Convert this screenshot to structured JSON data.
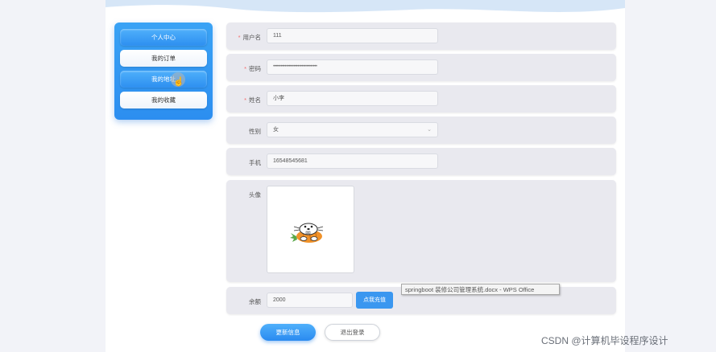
{
  "sidebar": {
    "items": [
      {
        "label": "个人中心",
        "active": true
      },
      {
        "label": "我的订单",
        "active": false
      },
      {
        "label": "我的地址",
        "active": true
      },
      {
        "label": "我的收藏",
        "active": false
      }
    ]
  },
  "form": {
    "username": {
      "label": "用户名",
      "required": "*",
      "value": "111"
    },
    "password": {
      "label": "密码",
      "required": "*",
      "value": "••••••••••••••••••••••••••••••••••"
    },
    "name": {
      "label": "姓名",
      "required": "*",
      "value": "小李"
    },
    "gender": {
      "label": "性别",
      "value": "女"
    },
    "phone": {
      "label": "手机",
      "value": "16548545681"
    },
    "avatar": {
      "label": "头像"
    },
    "balance": {
      "label": "余额",
      "value": "2000",
      "charge_label": "点我充值"
    }
  },
  "actions": {
    "update_label": "更新信息",
    "logout_label": "退出登录"
  },
  "tooltip_text": "springboot 装修公司管理系统.docx - WPS Office",
  "watermark_text": "CSDN @计算机毕设程序设计",
  "colors": {
    "accent": "#3a97f0",
    "required": "#f56c6c"
  }
}
